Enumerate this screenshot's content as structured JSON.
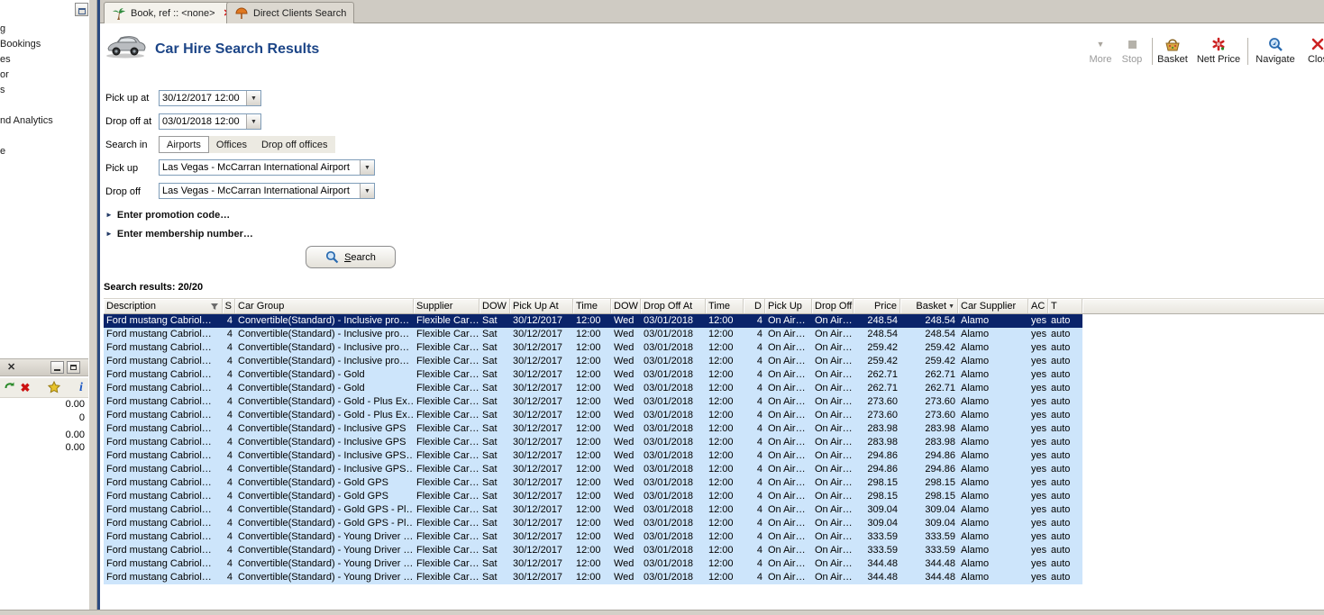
{
  "tabs": [
    {
      "label": "Book, ref :: <none>"
    },
    {
      "label": "Direct Clients Search"
    }
  ],
  "header": {
    "title": "Car Hire Search Results"
  },
  "toolbar": {
    "more": "More",
    "stop": "Stop",
    "basket": "Basket",
    "nett_price": "Nett Price",
    "navigate": "Navigate",
    "close": "Clos"
  },
  "form": {
    "pickup_at_label": "Pick up at",
    "pickup_at_value": "30/12/2017 12:00",
    "dropoff_at_label": "Drop off at",
    "dropoff_at_value": "03/01/2018 12:00",
    "search_in_label": "Search in",
    "search_in_tabs": [
      "Airports",
      "Offices",
      "Drop off offices"
    ],
    "pickup_label": "Pick up",
    "pickup_value": "Las Vegas - McCarran International Airport",
    "dropoff_label": "Drop off",
    "dropoff_value": "Las Vegas - McCarran International Airport",
    "promo_expander": "Enter promotion code…",
    "membership_expander": "Enter membership number…",
    "search_button_initial": "S",
    "search_button_rest": "earch"
  },
  "results": {
    "summary": "Search results: 20/20",
    "selected_row": 0,
    "columns": [
      "Description",
      "S",
      "Car Group",
      "Supplier",
      "DOW",
      "Pick Up At",
      "Time",
      "DOW",
      "Drop Off At",
      "Time",
      "D",
      "Pick Up",
      "Drop Off",
      "Price",
      "Basket",
      "Car Supplier",
      "AC",
      "T"
    ],
    "rows": [
      [
        "Ford mustang Cabriol…",
        "4",
        "Convertible(Standard) - Inclusive pro…",
        "Flexible Car…",
        "Sat",
        "30/12/2017",
        "12:00",
        "Wed",
        "03/01/2018",
        "12:00",
        "4",
        "On Air…",
        "On Air…",
        "248.54",
        "248.54",
        "Alamo",
        "yes",
        "auto"
      ],
      [
        "Ford mustang Cabriol…",
        "4",
        "Convertible(Standard) - Inclusive pro…",
        "Flexible Car…",
        "Sat",
        "30/12/2017",
        "12:00",
        "Wed",
        "03/01/2018",
        "12:00",
        "4",
        "On Air…",
        "On Air…",
        "248.54",
        "248.54",
        "Alamo",
        "yes",
        "auto"
      ],
      [
        "Ford mustang Cabriol…",
        "4",
        "Convertible(Standard) - Inclusive pro…",
        "Flexible Car…",
        "Sat",
        "30/12/2017",
        "12:00",
        "Wed",
        "03/01/2018",
        "12:00",
        "4",
        "On Air…",
        "On Air…",
        "259.42",
        "259.42",
        "Alamo",
        "yes",
        "auto"
      ],
      [
        "Ford mustang Cabriol…",
        "4",
        "Convertible(Standard) - Inclusive pro…",
        "Flexible Car…",
        "Sat",
        "30/12/2017",
        "12:00",
        "Wed",
        "03/01/2018",
        "12:00",
        "4",
        "On Air…",
        "On Air…",
        "259.42",
        "259.42",
        "Alamo",
        "yes",
        "auto"
      ],
      [
        "Ford mustang Cabriol…",
        "4",
        "Convertible(Standard) - Gold",
        "Flexible Car…",
        "Sat",
        "30/12/2017",
        "12:00",
        "Wed",
        "03/01/2018",
        "12:00",
        "4",
        "On Air…",
        "On Air…",
        "262.71",
        "262.71",
        "Alamo",
        "yes",
        "auto"
      ],
      [
        "Ford mustang Cabriol…",
        "4",
        "Convertible(Standard) - Gold",
        "Flexible Car…",
        "Sat",
        "30/12/2017",
        "12:00",
        "Wed",
        "03/01/2018",
        "12:00",
        "4",
        "On Air…",
        "On Air…",
        "262.71",
        "262.71",
        "Alamo",
        "yes",
        "auto"
      ],
      [
        "Ford mustang Cabriol…",
        "4",
        "Convertible(Standard) - Gold - Plus Ex…",
        "Flexible Car…",
        "Sat",
        "30/12/2017",
        "12:00",
        "Wed",
        "03/01/2018",
        "12:00",
        "4",
        "On Air…",
        "On Air…",
        "273.60",
        "273.60",
        "Alamo",
        "yes",
        "auto"
      ],
      [
        "Ford mustang Cabriol…",
        "4",
        "Convertible(Standard) - Gold - Plus Ex…",
        "Flexible Car…",
        "Sat",
        "30/12/2017",
        "12:00",
        "Wed",
        "03/01/2018",
        "12:00",
        "4",
        "On Air…",
        "On Air…",
        "273.60",
        "273.60",
        "Alamo",
        "yes",
        "auto"
      ],
      [
        "Ford mustang Cabriol…",
        "4",
        "Convertible(Standard) - Inclusive GPS",
        "Flexible Car…",
        "Sat",
        "30/12/2017",
        "12:00",
        "Wed",
        "03/01/2018",
        "12:00",
        "4",
        "On Air…",
        "On Air…",
        "283.98",
        "283.98",
        "Alamo",
        "yes",
        "auto"
      ],
      [
        "Ford mustang Cabriol…",
        "4",
        "Convertible(Standard) - Inclusive GPS",
        "Flexible Car…",
        "Sat",
        "30/12/2017",
        "12:00",
        "Wed",
        "03/01/2018",
        "12:00",
        "4",
        "On Air…",
        "On Air…",
        "283.98",
        "283.98",
        "Alamo",
        "yes",
        "auto"
      ],
      [
        "Ford mustang Cabriol…",
        "4",
        "Convertible(Standard) - Inclusive GPS…",
        "Flexible Car…",
        "Sat",
        "30/12/2017",
        "12:00",
        "Wed",
        "03/01/2018",
        "12:00",
        "4",
        "On Air…",
        "On Air…",
        "294.86",
        "294.86",
        "Alamo",
        "yes",
        "auto"
      ],
      [
        "Ford mustang Cabriol…",
        "4",
        "Convertible(Standard) - Inclusive GPS…",
        "Flexible Car…",
        "Sat",
        "30/12/2017",
        "12:00",
        "Wed",
        "03/01/2018",
        "12:00",
        "4",
        "On Air…",
        "On Air…",
        "294.86",
        "294.86",
        "Alamo",
        "yes",
        "auto"
      ],
      [
        "Ford mustang Cabriol…",
        "4",
        "Convertible(Standard) - Gold GPS",
        "Flexible Car…",
        "Sat",
        "30/12/2017",
        "12:00",
        "Wed",
        "03/01/2018",
        "12:00",
        "4",
        "On Air…",
        "On Air…",
        "298.15",
        "298.15",
        "Alamo",
        "yes",
        "auto"
      ],
      [
        "Ford mustang Cabriol…",
        "4",
        "Convertible(Standard) - Gold GPS",
        "Flexible Car…",
        "Sat",
        "30/12/2017",
        "12:00",
        "Wed",
        "03/01/2018",
        "12:00",
        "4",
        "On Air…",
        "On Air…",
        "298.15",
        "298.15",
        "Alamo",
        "yes",
        "auto"
      ],
      [
        "Ford mustang Cabriol…",
        "4",
        "Convertible(Standard) - Gold GPS - Pl…",
        "Flexible Car…",
        "Sat",
        "30/12/2017",
        "12:00",
        "Wed",
        "03/01/2018",
        "12:00",
        "4",
        "On Air…",
        "On Air…",
        "309.04",
        "309.04",
        "Alamo",
        "yes",
        "auto"
      ],
      [
        "Ford mustang Cabriol…",
        "4",
        "Convertible(Standard) - Gold GPS - Pl…",
        "Flexible Car…",
        "Sat",
        "30/12/2017",
        "12:00",
        "Wed",
        "03/01/2018",
        "12:00",
        "4",
        "On Air…",
        "On Air…",
        "309.04",
        "309.04",
        "Alamo",
        "yes",
        "auto"
      ],
      [
        "Ford mustang Cabriol…",
        "4",
        "Convertible(Standard) - Young Driver …",
        "Flexible Car…",
        "Sat",
        "30/12/2017",
        "12:00",
        "Wed",
        "03/01/2018",
        "12:00",
        "4",
        "On Air…",
        "On Air…",
        "333.59",
        "333.59",
        "Alamo",
        "yes",
        "auto"
      ],
      [
        "Ford mustang Cabriol…",
        "4",
        "Convertible(Standard) - Young Driver …",
        "Flexible Car…",
        "Sat",
        "30/12/2017",
        "12:00",
        "Wed",
        "03/01/2018",
        "12:00",
        "4",
        "On Air…",
        "On Air…",
        "333.59",
        "333.59",
        "Alamo",
        "yes",
        "auto"
      ],
      [
        "Ford mustang Cabriol…",
        "4",
        "Convertible(Standard) - Young Driver …",
        "Flexible Car…",
        "Sat",
        "30/12/2017",
        "12:00",
        "Wed",
        "03/01/2018",
        "12:00",
        "4",
        "On Air…",
        "On Air…",
        "344.48",
        "344.48",
        "Alamo",
        "yes",
        "auto"
      ],
      [
        "Ford mustang Cabriol…",
        "4",
        "Convertible(Standard) - Young Driver …",
        "Flexible Car…",
        "Sat",
        "30/12/2017",
        "12:00",
        "Wed",
        "03/01/2018",
        "12:00",
        "4",
        "On Air…",
        "On Air…",
        "344.48",
        "344.48",
        "Alamo",
        "yes",
        "auto"
      ]
    ]
  },
  "sidebar": {
    "items": [
      "g",
      "Bookings",
      "es",
      "or",
      "s",
      "nd Analytics",
      "e"
    ],
    "panel_values": [
      "0.00",
      "0",
      "0.00",
      "0.00"
    ]
  },
  "icons": {
    "combo_arrow": "▼",
    "expander_arrow": "►",
    "more_arrow": "▼",
    "tab_close": "✕",
    "panel_close": "✕",
    "delete_x": "✖",
    "sort_desc": "▼",
    "info": "i"
  },
  "colors": {
    "title": "#1c4587",
    "selected_row_bg": "#0a246a",
    "row_bg": "#cde5fb",
    "tab_strip": "#cfcbc3"
  }
}
